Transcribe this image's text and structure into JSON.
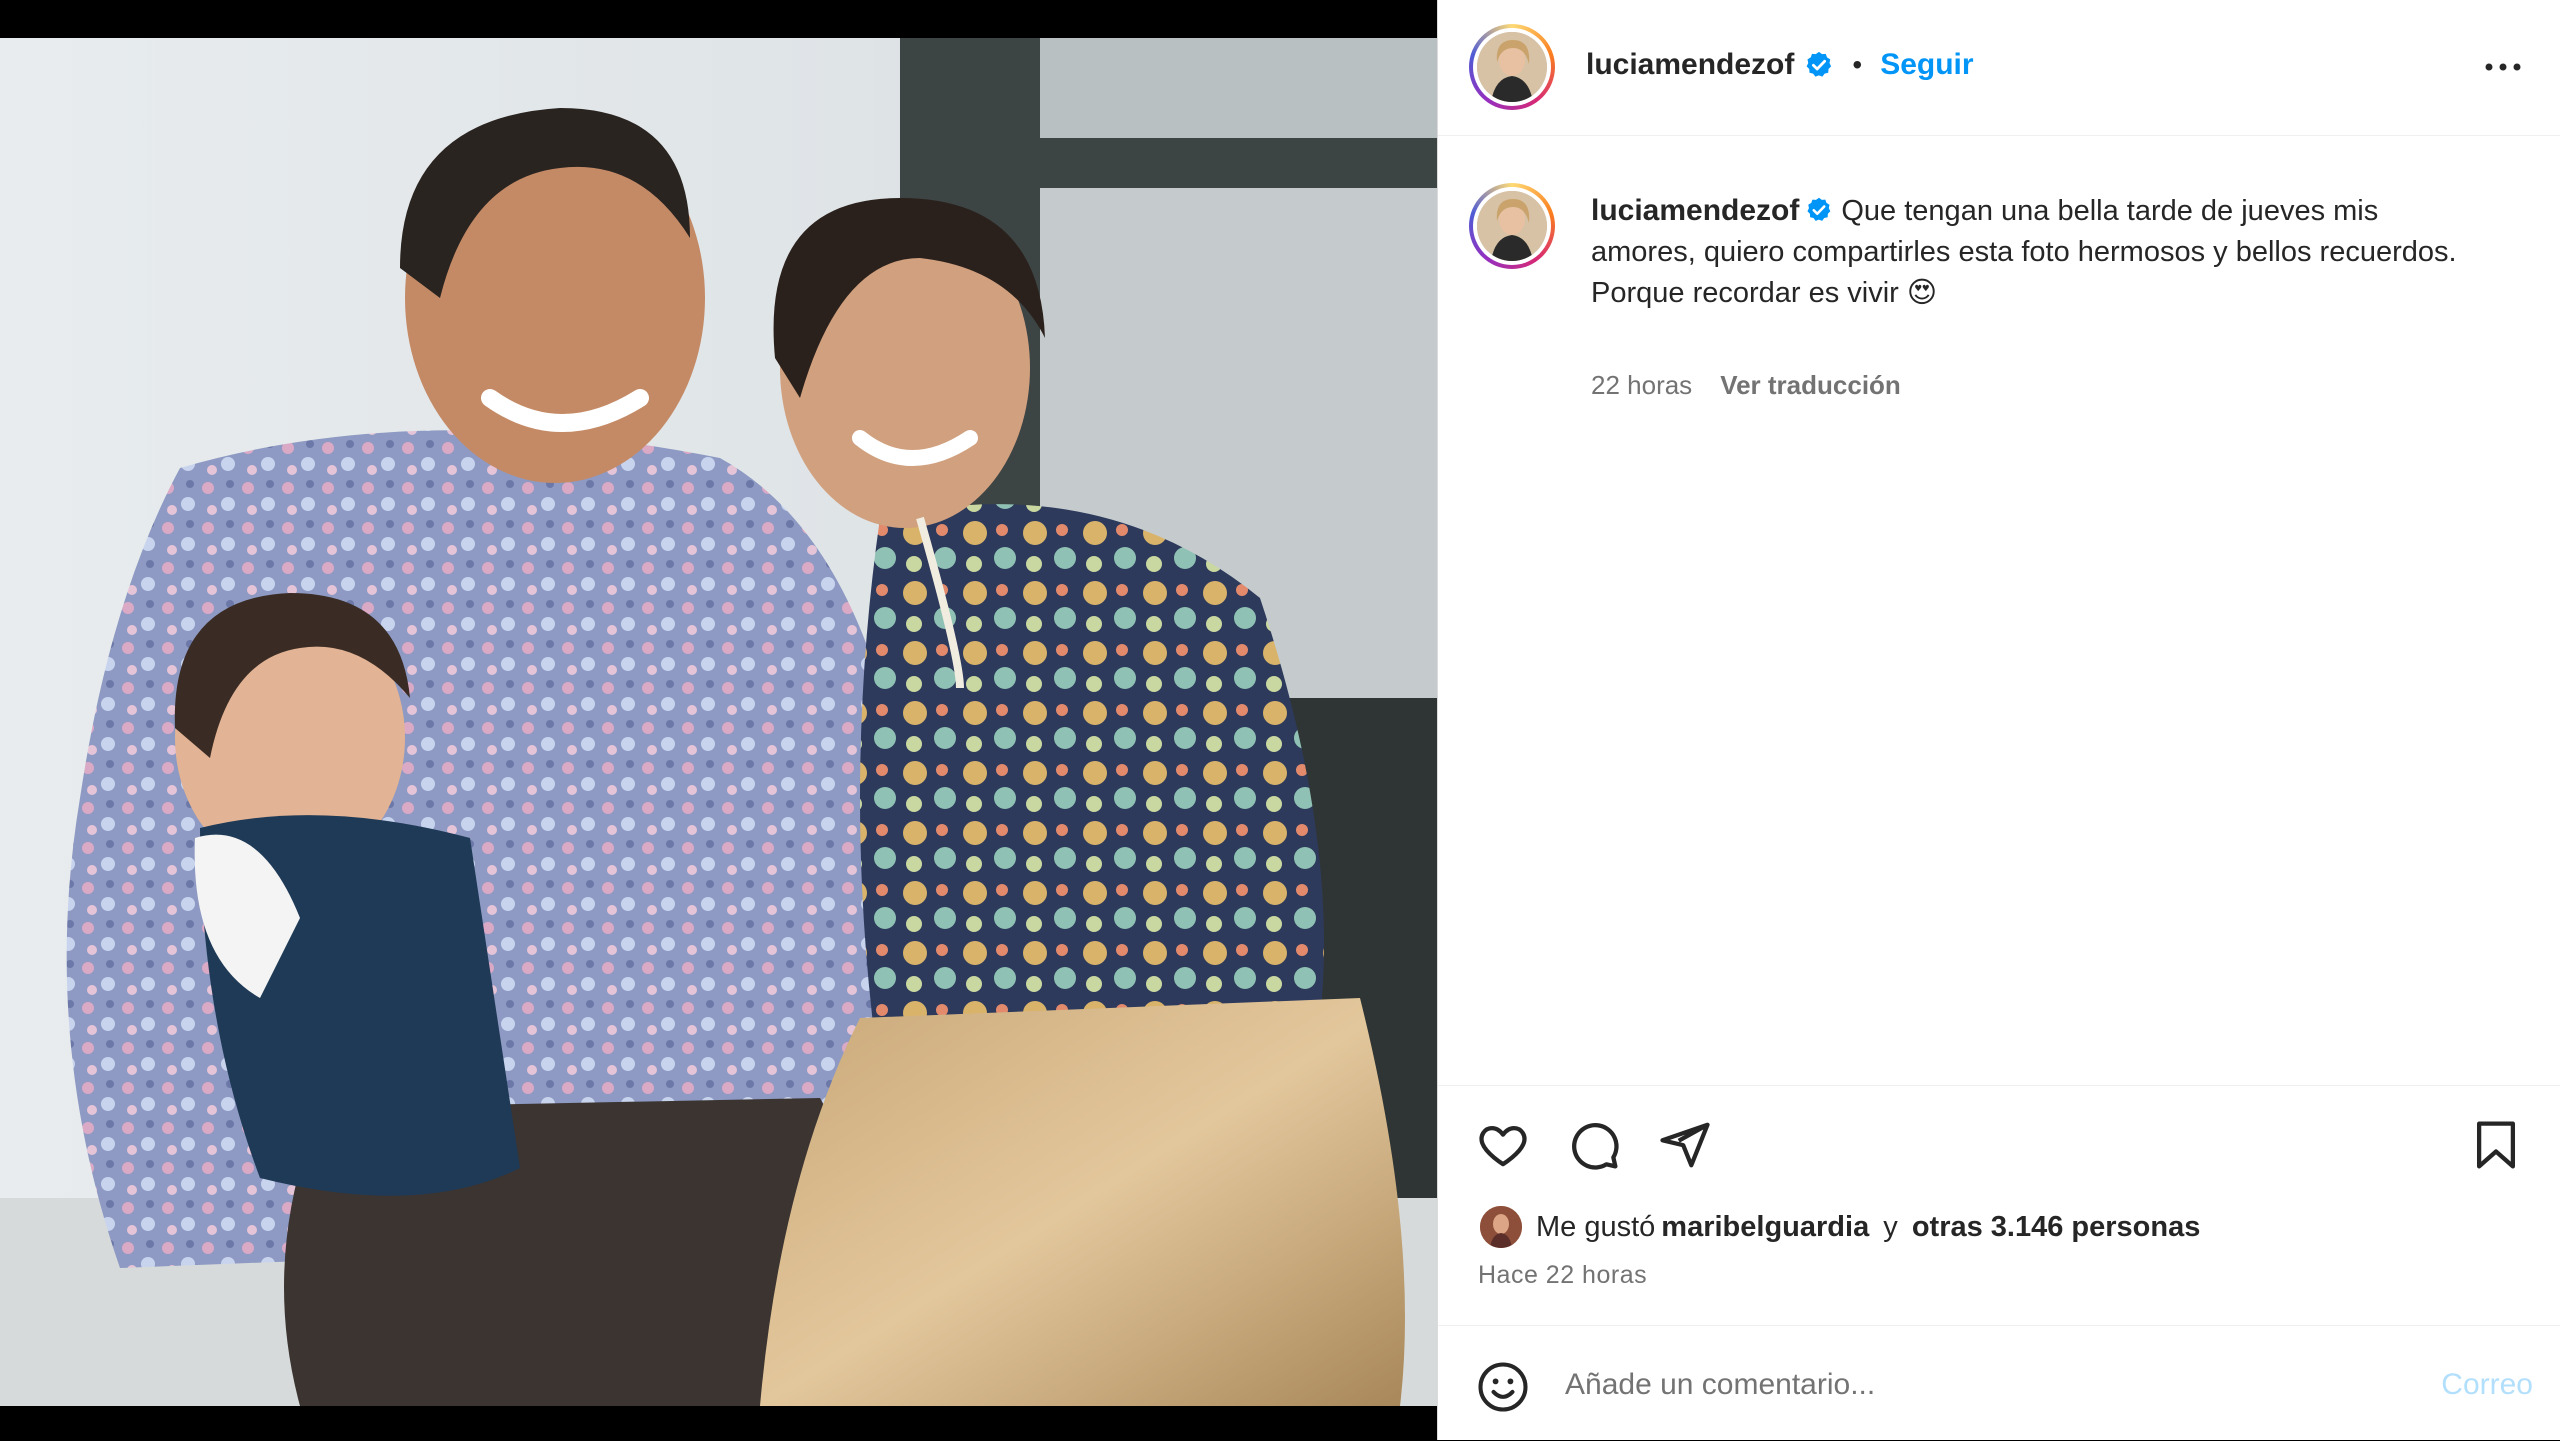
{
  "post": {
    "username": "luciamendezof",
    "separator": "•",
    "follow_label": "Seguir",
    "caption_lines": [
      "Que tengan una bella tarde de jueves mis amores, quiero compartirles esta foto hermosos y bellos recuerdos.",
      "Porque recordar es vivir 😍"
    ],
    "caption_time": "22 horas",
    "translate_label": "Ver traducción",
    "likes": {
      "prefix": "Me gustó",
      "liker": "maribelguardia",
      "middle": " y ",
      "others": "otras 3.146 personas"
    },
    "time_ago": "Hace 22 horas"
  },
  "comment": {
    "placeholder": "Añade un comentario...",
    "post_label": "Correo"
  },
  "icons": {
    "more": "more-options-icon",
    "verified": "verified-badge-icon",
    "like": "heart-icon",
    "comment": "comment-icon",
    "share": "send-icon",
    "save": "bookmark-icon",
    "emoji": "emoji-icon"
  },
  "colors": {
    "accent": "#0095f6",
    "text": "#262626",
    "muted": "#737373",
    "post_disabled": "#b2dffc"
  }
}
